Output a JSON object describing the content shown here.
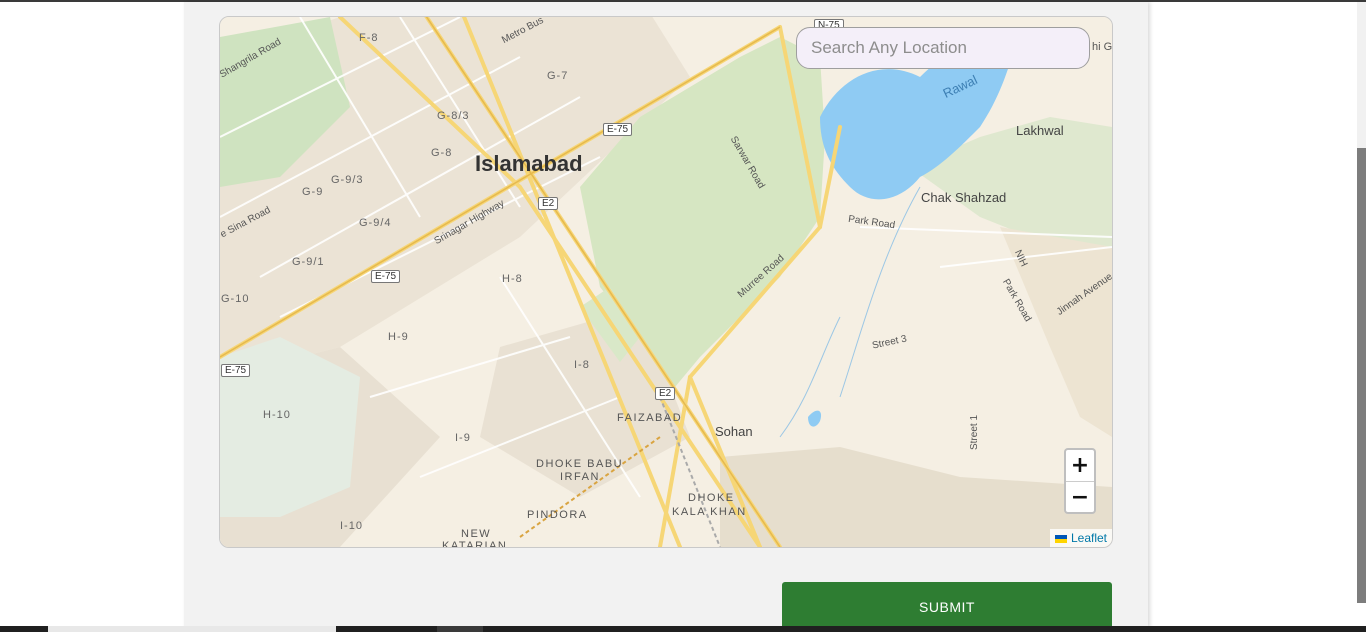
{
  "search": {
    "placeholder": "Search Any Location"
  },
  "map": {
    "zoom_in_label": "+",
    "zoom_out_label": "−",
    "attribution": "Leaflet",
    "labels": {
      "islamabad": "Islamabad",
      "chak_shahzad": "Chak Shahzad",
      "lakhwal": "Lakhwal",
      "sohan": "Sohan",
      "rawal": "Rawal",
      "faizabad": "FAIZABAD",
      "dhoke_babu": "DHOKE BABU",
      "irfan": "IRFAN",
      "dhoke": "DHOKE",
      "kala_khan": "KALA KHAN",
      "pindora": "PINDORA",
      "new": "NEW",
      "katarian": "KATARIAN",
      "f8": "F-8",
      "g7": "G-7",
      "g83": "G-8/3",
      "g8": "G-8",
      "g93": "G-9/3",
      "g9": "G-9",
      "g94": "G-9/4",
      "g91": "G-9/1",
      "g10": "G-10",
      "h8": "H-8",
      "h9": "H-9",
      "h10": "H-10",
      "i8": "I-8",
      "i9": "I-9",
      "i10": "I-10",
      "shangrila_road": "Shangrila Road",
      "metro_bus": "Metro Bus",
      "srinagar_highway": "Srinagar Highway",
      "sina_road": "e Sina Road",
      "sarwar_road": "Sarwar Road",
      "park_road": "Park Road",
      "park_road_2": "Park Road",
      "murree_road": "Murree Road",
      "nih": "NIH",
      "jinnah_avenue": "Jinnah Avenue",
      "street_3": "Street 3",
      "street_1": "Street 1",
      "hi_g": "hi G"
    },
    "shields": {
      "e75_a": "E-75",
      "e75_b": "E-75",
      "e75_c": "E-75",
      "e2_a": "E2",
      "e2_b": "E2",
      "n75": "N-75"
    }
  },
  "form": {
    "submit_label": "SUBMIT"
  }
}
